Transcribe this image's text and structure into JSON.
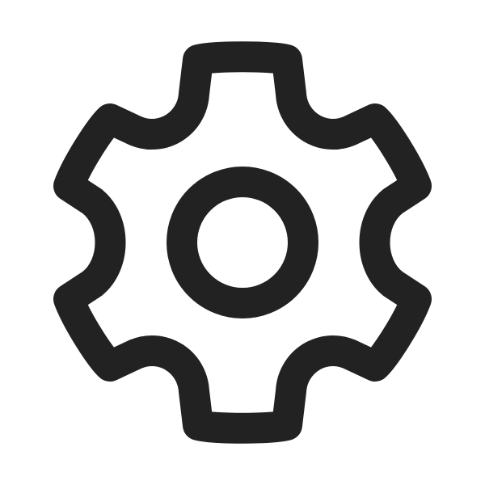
{
  "icon": {
    "name": "gear-icon",
    "stroke_color": "#222222",
    "background_color": "#ffffff"
  }
}
